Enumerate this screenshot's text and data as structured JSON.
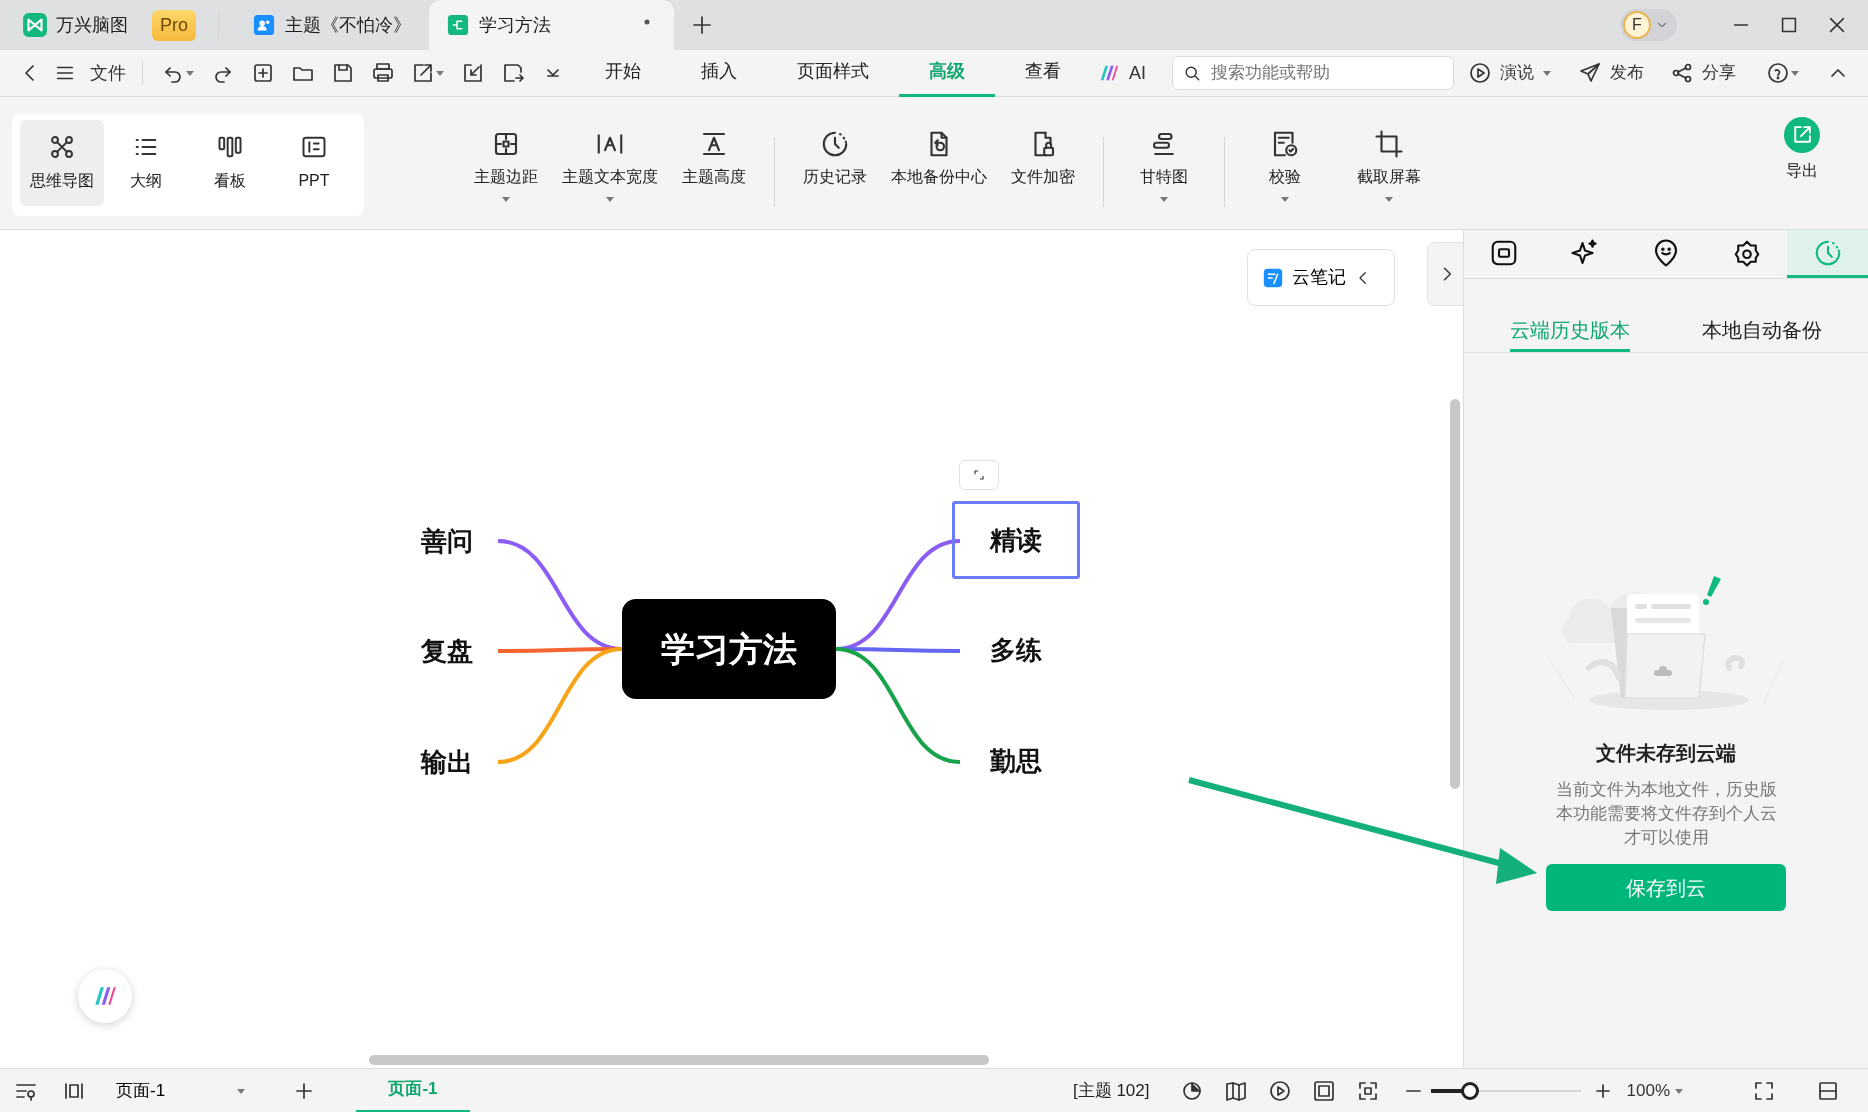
{
  "app": {
    "name": "万兴脑图",
    "badge": "Pro"
  },
  "document_tabs": [
    {
      "label": "主题《不怕冷》",
      "selected": false,
      "unsaved": false
    },
    {
      "label": "学习方法",
      "selected": true,
      "unsaved": true
    }
  ],
  "account": {
    "initial": "F"
  },
  "file_menu": "文件",
  "menu_tabs": [
    {
      "label": "开始",
      "selected": false
    },
    {
      "label": "插入",
      "selected": false
    },
    {
      "label": "页面样式",
      "selected": false
    },
    {
      "label": "高级",
      "selected": true
    },
    {
      "label": "查看",
      "selected": false
    }
  ],
  "ai_button": "AI",
  "search": {
    "placeholder": "搜索功能或帮助"
  },
  "actions": [
    {
      "label": "演说",
      "dropdown": true
    },
    {
      "label": "发布",
      "dropdown": false
    },
    {
      "label": "分享",
      "dropdown": false
    }
  ],
  "views": [
    {
      "label": "思维导图",
      "selected": true
    },
    {
      "label": "大纲",
      "selected": false
    },
    {
      "label": "看板",
      "selected": false
    },
    {
      "label": "PPT",
      "selected": false
    }
  ],
  "tool_groups": [
    {
      "tools": [
        {
          "label": "主题边距",
          "dropdown": true
        },
        {
          "label": "主题文本宽度",
          "dropdown": true
        },
        {
          "label": "主题高度",
          "dropdown": false
        }
      ]
    },
    {
      "tools": [
        {
          "label": "历史记录",
          "dropdown": false
        },
        {
          "label": "本地备份中心",
          "dropdown": false
        },
        {
          "label": "文件加密",
          "dropdown": false
        }
      ]
    },
    {
      "tools": [
        {
          "label": "甘特图",
          "dropdown": true
        }
      ]
    },
    {
      "tools": [
        {
          "label": "校验",
          "dropdown": true
        },
        {
          "label": "截取屏幕",
          "dropdown": true
        }
      ]
    }
  ],
  "export": "导出",
  "cloud_note": "云笔记",
  "mind_map": {
    "root": "学习方法",
    "left_branches": [
      {
        "label": "善问",
        "color": "#8b5cf6",
        "selected": false
      },
      {
        "label": "复盘",
        "color": "#f26430",
        "selected": false
      },
      {
        "label": "输出",
        "color": "#f7a516",
        "selected": false
      }
    ],
    "right_branches": [
      {
        "label": "精读",
        "color": "#8a5cf0",
        "selected": true
      },
      {
        "label": "多练",
        "color": "#6366f1",
        "selected": false
      },
      {
        "label": "勤思",
        "color": "#16a34a",
        "selected": false
      }
    ]
  },
  "side_tabs": [
    {
      "selected": false
    },
    {
      "selected": false
    },
    {
      "selected": false
    },
    {
      "selected": false
    },
    {
      "selected": true
    }
  ],
  "history_tabs": [
    {
      "label": "云端历史版本",
      "selected": true
    },
    {
      "label": "本地自动备份",
      "selected": false
    }
  ],
  "empty_state": {
    "title": "文件未存到云端",
    "message": "当前文件为本地文件，历史版本功能需要将文件存到个人云才可以使用",
    "button": "保存到云"
  },
  "status_bar": {
    "page_select": "页面-1",
    "pages": [
      {
        "label": "页面-1",
        "selected": true
      }
    ],
    "topic_count": "[主题 102]",
    "zoom": {
      "level": 0.26,
      "reading": "100%"
    }
  }
}
